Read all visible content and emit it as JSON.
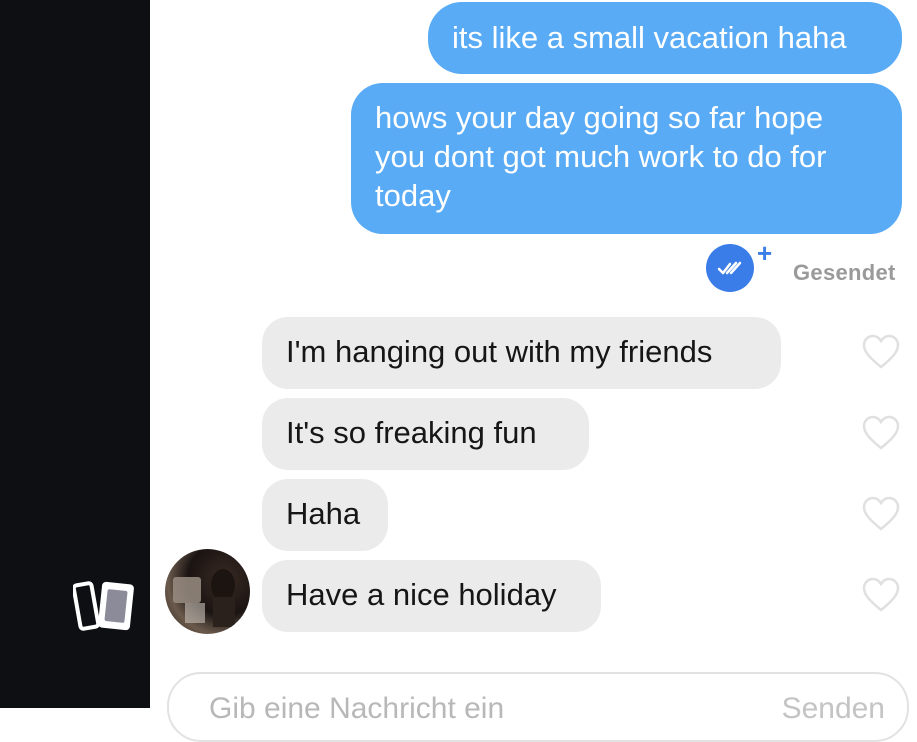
{
  "messages": {
    "outgoing": [
      "its like a small vacation haha",
      "hows your day going so far hope\nyou dont got much work to do for\ntoday"
    ],
    "status": "Gesendet",
    "incoming": [
      "I'm hanging out with my friends",
      "It's so freaking fun",
      "Haha",
      "Have a nice holiday"
    ]
  },
  "composer": {
    "placeholder": "Gib eine Nachricht ein",
    "send_label": "Senden"
  },
  "colors": {
    "outgoing_bubble": "#5aabf5",
    "incoming_bubble": "#ebebeb",
    "accent": "#3a7de8"
  },
  "icons": {
    "left_rail": "cards-icon",
    "status": "double-check-icon",
    "status_extra": "plus-icon",
    "like": "heart-icon"
  }
}
